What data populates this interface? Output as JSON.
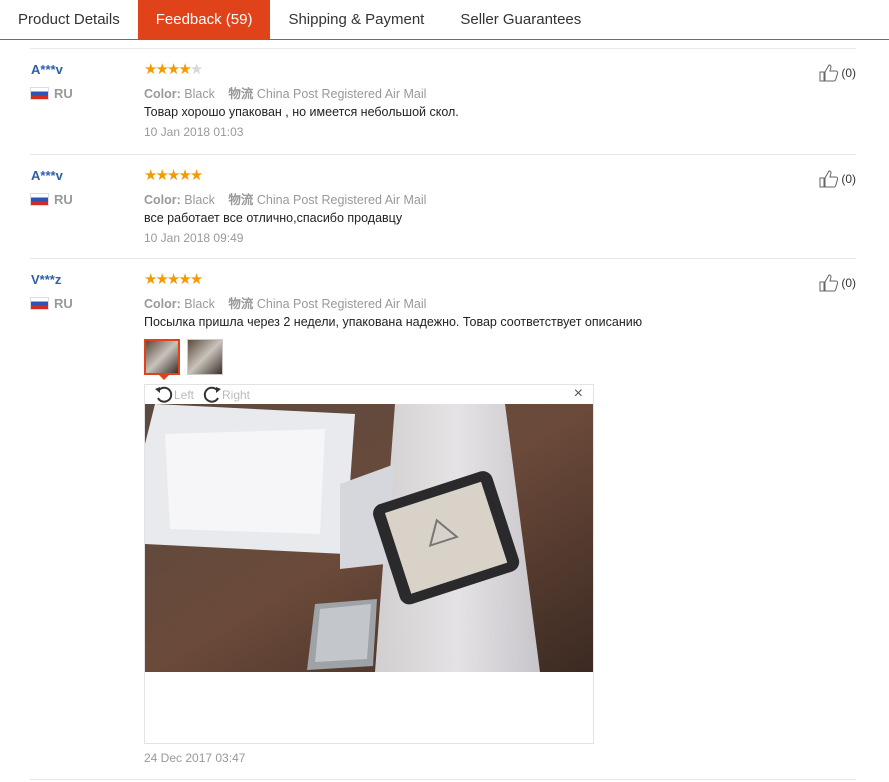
{
  "tabs": [
    {
      "label": "Product Details"
    },
    {
      "label": "Feedback (59)"
    },
    {
      "label": "Shipping & Payment"
    },
    {
      "label": "Seller Guarantees"
    }
  ],
  "reviews": [
    {
      "buyer": "A***v",
      "country": "RU",
      "rating": 4,
      "color_label": "Color:",
      "color_value": "Black",
      "shipping_label": "物流",
      "shipping_value": "China Post Registered Air Mail",
      "text": "Товар хорошо упакован , но имеется небольшой скол.",
      "date": "10 Jan 2018 01:03",
      "helpful": "(0)"
    },
    {
      "buyer": "A***v",
      "country": "RU",
      "rating": 5,
      "color_label": "Color:",
      "color_value": "Black",
      "shipping_label": "物流",
      "shipping_value": "China Post Registered Air Mail",
      "text": "все работает все отлично,спасибо продавцу",
      "date": "10 Jan 2018 09:49",
      "helpful": "(0)"
    },
    {
      "buyer": "V***z",
      "country": "RU",
      "rating": 5,
      "color_label": "Color:",
      "color_value": "Black",
      "shipping_label": "物流",
      "shipping_value": "China Post Registered Air Mail",
      "text": "Посылка пришла через 2 недели, упакована надежно. Товар соответствует описанию",
      "date": "24 Dec 2017 03:47",
      "helpful": "(0)"
    }
  ],
  "viewer": {
    "rotate_left": "Left",
    "rotate_right": "Right",
    "close": "×"
  },
  "colors": {
    "accent": "#e0431a",
    "buyer": "#2d5fa8",
    "star": "#f59a00"
  }
}
